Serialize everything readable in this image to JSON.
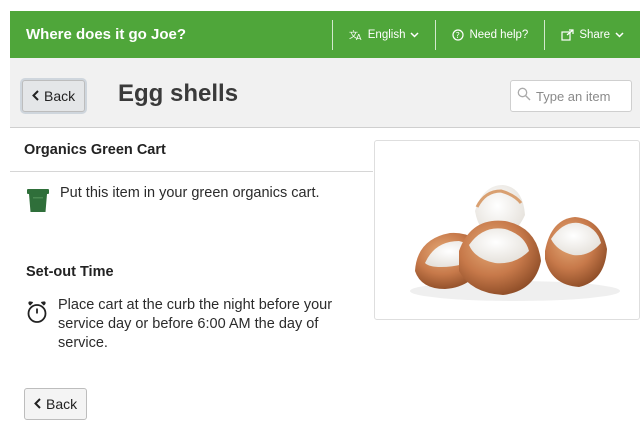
{
  "app": {
    "title": "Where does it go Joe?"
  },
  "nav": {
    "language": "English",
    "help": "Need help?",
    "share": "Share"
  },
  "header": {
    "back_label": "Back",
    "item_title": "Egg shells",
    "search_placeholder": "Type an item"
  },
  "disposal": {
    "category": "Organics Green Cart",
    "instruction": "Put this item in your green organics cart.",
    "cart_color": "#2f6f3a"
  },
  "set_out": {
    "heading": "Set-out Time",
    "instruction": "Place cart at the curb the night before your service day or before 6:00 AM the day of service."
  },
  "footer": {
    "back_label": "Back"
  },
  "colors": {
    "brand": "#4fa63a"
  }
}
